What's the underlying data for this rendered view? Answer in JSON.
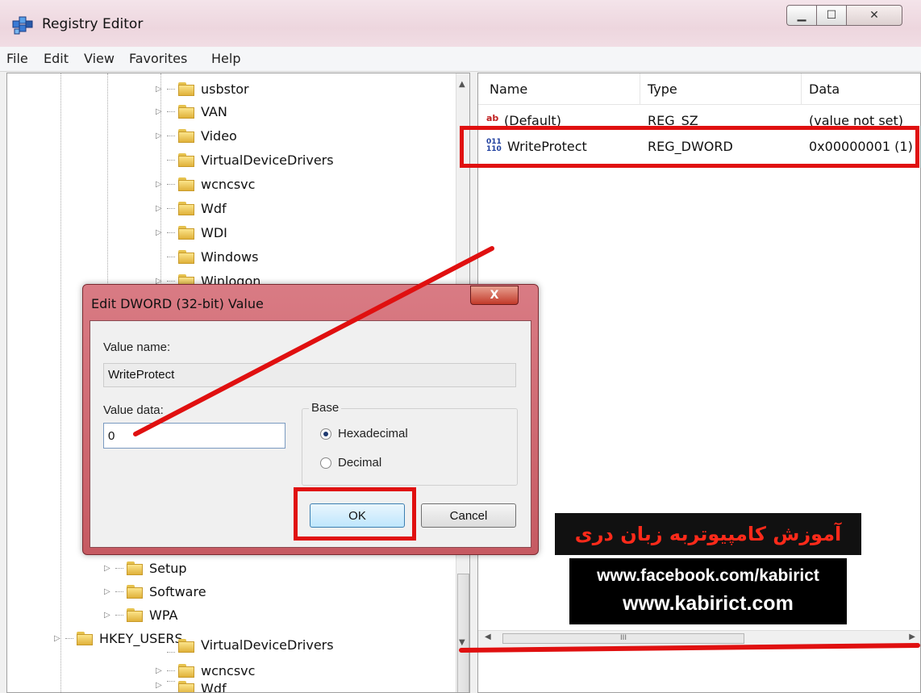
{
  "window": {
    "title": "Registry Editor"
  },
  "menu": [
    "File",
    "Edit",
    "View",
    "Favorites",
    "Help"
  ],
  "tree": {
    "items": [
      {
        "label": "usbstor",
        "expandable": true
      },
      {
        "label": "VAN",
        "expandable": true
      },
      {
        "label": "Video",
        "expandable": true
      },
      {
        "label": "VirtualDeviceDrivers",
        "expandable": false
      },
      {
        "label": "wcncsvc",
        "expandable": true
      },
      {
        "label": "Wdf",
        "expandable": true
      },
      {
        "label": "WDI",
        "expandable": true
      },
      {
        "label": "Windows",
        "expandable": false
      },
      {
        "label": "Winlogon",
        "expandable": true
      }
    ],
    "lower_items": [
      {
        "label": "Setup",
        "expandable": true
      },
      {
        "label": "Software",
        "expandable": true
      },
      {
        "label": "WPA",
        "expandable": true
      },
      {
        "label": "HKEY_USERS",
        "expandable": true
      },
      {
        "label": "VirtualDeviceDrivers",
        "expandable": false
      },
      {
        "label": "wcncsvc",
        "expandable": true
      },
      {
        "label": "Wdf",
        "expandable": true
      }
    ]
  },
  "values": {
    "columns": [
      "Name",
      "Type",
      "Data"
    ],
    "rows": [
      {
        "icon": "string-value-icon",
        "name": "(Default)",
        "type": "REG_SZ",
        "data": "(value not set)"
      },
      {
        "icon": "dword-value-icon",
        "name": "WriteProtect",
        "type": "REG_DWORD",
        "data": "0x00000001 (1)"
      }
    ],
    "hscroll_grip": "III"
  },
  "dialog": {
    "title": "Edit DWORD (32-bit) Value",
    "close_label": "X",
    "value_name_label": "Value name:",
    "value_name": "WriteProtect",
    "value_data_label": "Value data:",
    "value_data": "0",
    "base_label": "Base",
    "options": [
      {
        "label": "Hexadecimal",
        "selected": true
      },
      {
        "label": "Decimal",
        "selected": false
      }
    ],
    "ok_label": "OK",
    "cancel_label": "Cancel"
  },
  "banner": {
    "title": "آموزش کامپیوتربه زبان دری",
    "line1": "www.facebook.com/kabirict",
    "line2": "www.kabirict.com"
  },
  "annotation_color": "#e01010"
}
